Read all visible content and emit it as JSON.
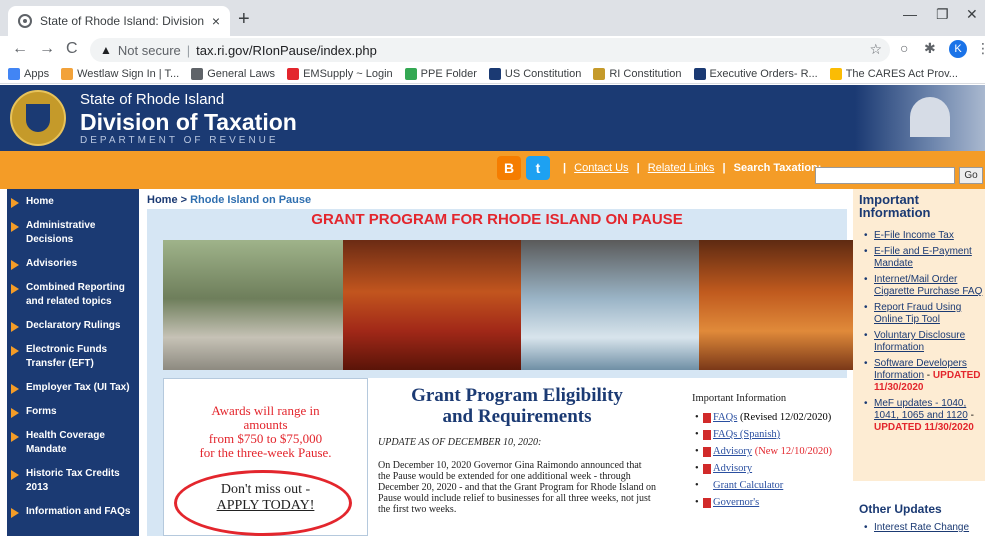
{
  "browser": {
    "tab_title": "State of Rhode Island: Division of",
    "tab_close": "×",
    "new_tab": "+",
    "minimize": "—",
    "restore": "❐",
    "close": "✕",
    "back": "←",
    "forward": "→",
    "reload": "C",
    "not_secure": "Not secure",
    "url": "tax.ri.gov/RIonPause/index.php",
    "star": "☆",
    "profile_initial": "K",
    "bookmarks": [
      {
        "label": "Apps",
        "color": "#4285f4"
      },
      {
        "label": "Westlaw Sign In | T...",
        "color": "#f2a23a"
      },
      {
        "label": "General Laws",
        "color": "#5f6368"
      },
      {
        "label": "EMSupply ~ Login",
        "color": "#e3262d"
      },
      {
        "label": "PPE Folder",
        "color": "#34a853"
      },
      {
        "label": "US Constitution",
        "color": "#1b3a73"
      },
      {
        "label": "RI Constitution",
        "color": "#c59a2a"
      },
      {
        "label": "Executive Orders- R...",
        "color": "#1b3a73"
      },
      {
        "label": "The CARES Act Prov...",
        "color": "#fbbc04"
      }
    ]
  },
  "header": {
    "line1": "State of Rhode Island",
    "line2": "Division of Taxation",
    "line3": "DEPARTMENT OF REVENUE"
  },
  "toolbar": {
    "blogger": "B",
    "twitter": "t",
    "contact": "Contact Us",
    "related": "Related Links",
    "search_label": "Search Taxation:",
    "go": "Go"
  },
  "nav": [
    "Home",
    "Administrative Decisions",
    "Advisories",
    "Combined Reporting and related topics",
    "Declaratory Rulings",
    "Electronic Funds Transfer (EFT)",
    "Employer Tax (UI Tax)",
    "Forms",
    "Health Coverage Mandate",
    "Historic Tax Credits 2013",
    "Information and FAQs"
  ],
  "breadcrumb": {
    "home": "Home",
    "sep": " > ",
    "current": "Rhode Island on Pause"
  },
  "main": {
    "title": "GRANT PROGRAM FOR RHODE ISLAND ON PAUSE",
    "award_l1": "Awards will range in",
    "award_l2": "amounts",
    "award_l3": "from $750 to $75,000",
    "award_l4": "for the three-week Pause.",
    "cta_l1": "Don't miss out -",
    "cta_l2": "APPLY TODAY!",
    "elig_l1": "Grant Program Eligibility",
    "elig_l2": "and Requirements",
    "update": "UPDATE AS OF DECEMBER 10, 2020:",
    "para": "On December 10, 2020 Governor Gina Raimondo announced that the Pause would be extended for one additional week - through December 20, 2020 - and that the Grant Program for Rhode Island on Pause would include relief to businesses for all three weeks, not just the first two weeks."
  },
  "info": {
    "heading": "Important Information",
    "items": [
      {
        "link": "FAQs",
        "note": " (Revised 12/02/2020)",
        "red": ""
      },
      {
        "link": "FAQs (Spanish)",
        "note": "",
        "red": ""
      },
      {
        "link": "Advisory",
        "note": "",
        "red": " (New 12/10/2020)"
      },
      {
        "link": "Advisory",
        "note": "",
        "red": ""
      },
      {
        "link": "Grant Calculator",
        "note": "",
        "red": ""
      },
      {
        "link": "Governor's",
        "note": "",
        "red": ""
      }
    ]
  },
  "right": {
    "title_l1": "Important",
    "title_l2": "Information",
    "items": [
      {
        "text": "E-File Income Tax",
        "upd": ""
      },
      {
        "text": "E-File and E-Payment Mandate",
        "upd": ""
      },
      {
        "text": "Internet/Mail Order Cigarette Purchase FAQ",
        "upd": ""
      },
      {
        "text": "Report Fraud Using Online Tip Tool",
        "upd": ""
      },
      {
        "text": "Voluntary Disclosure Information",
        "upd": ""
      },
      {
        "text": "Software Developers Information",
        "upd": "UPDATED 11/30/2020"
      },
      {
        "text": "MeF updates - 1040, 1041, 1065 and 1120",
        "upd": "UPDATED 11/30/2020"
      }
    ],
    "other_title": "Other Updates",
    "other_items": [
      "Interest Rate Change"
    ]
  }
}
